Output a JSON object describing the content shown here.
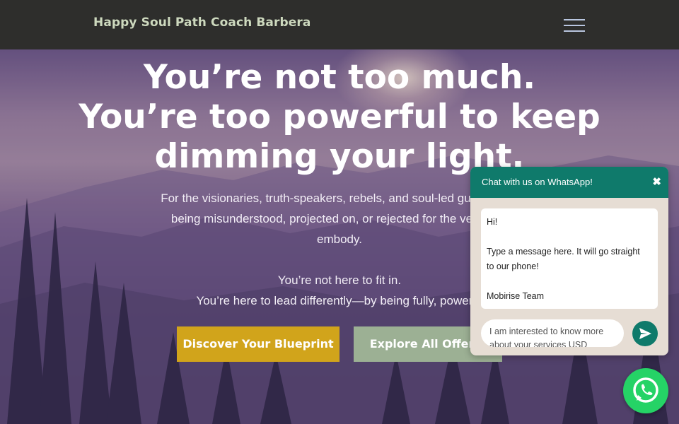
{
  "navbar": {
    "brand": "Happy Soul Path Coach Barbera",
    "menu_icon": "hamburger-menu-icon"
  },
  "hero": {
    "headline_lines": [
      "You’re not too much.",
      "You’re too powerful to keep",
      "dimming your light."
    ],
    "subtext_lines": [
      "For the visionaries, truth-speakers, rebels, and soul-led guides who",
      "being misunderstood, projected on, or rejected for the very gifts",
      "embody.",
      "",
      "You’re not here to fit in.",
      "You’re here to lead differently—by being fully, powerfu"
    ],
    "primary_button": "Discover Your Blueprint",
    "secondary_button": "Explore All Offerin"
  },
  "chat": {
    "header": " Chat with us on WhatsApp!",
    "close_icon": "close-icon",
    "message_lines": [
      "Hi!",
      "",
      "Type a message here. It will go straight",
      "to our phone! ",
      "",
      "Mobirise Team"
    ],
    "input_value": "I am interested to know more about your services USD",
    "send_icon": "send-icon"
  },
  "whatsapp_button": {
    "icon": "whatsapp-icon"
  },
  "colors": {
    "navbar": "#2e2e2c",
    "brand_text": "#cdd9be",
    "primary_button": "#d1a41b",
    "secondary_button": "#9cb094",
    "whatsapp_header": "#0f7a6b",
    "whatsapp_fab": "#25d366"
  }
}
